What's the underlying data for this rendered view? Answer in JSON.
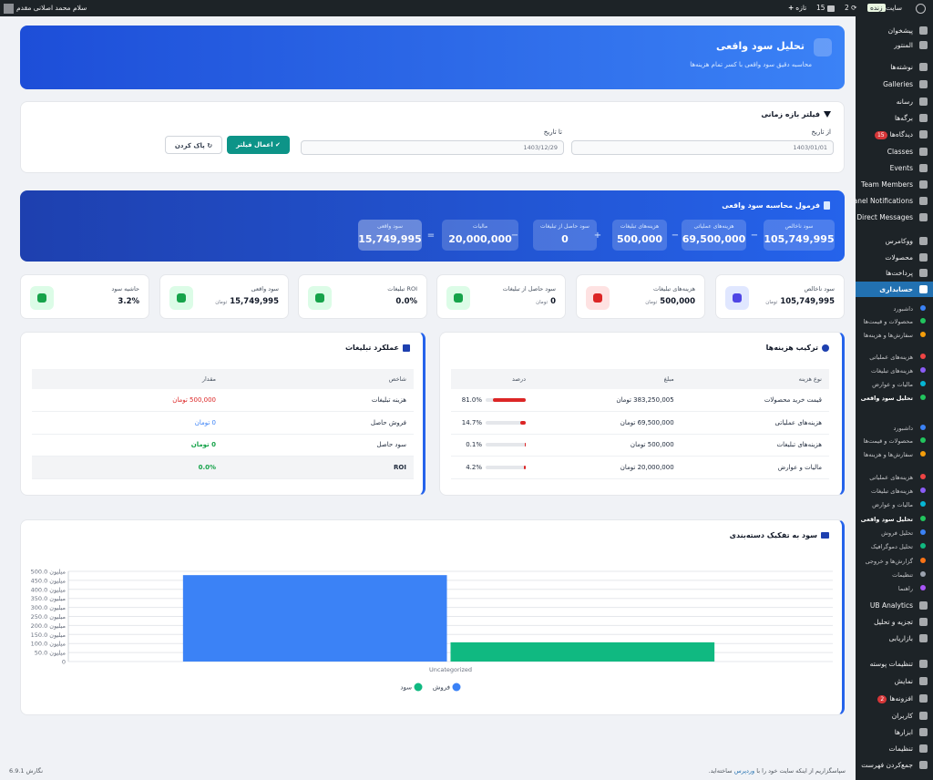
{
  "adminbar": {
    "greeting": "سلام محمد اصلانی مقدم",
    "site_name": "سایت",
    "live_badge": "زنده",
    "updates_count": "2",
    "comments_count": "15",
    "new_label": "تازه"
  },
  "sidebar": {
    "items": [
      {
        "label": "پیشخوان",
        "icon": "dashboard-icon"
      },
      {
        "label": "المنتور",
        "icon": "elementor-icon"
      },
      {
        "label": "نوشته‌ها",
        "icon": "pin-icon"
      },
      {
        "label": "Galleries",
        "icon": "gallery-icon"
      },
      {
        "label": "رسانه",
        "icon": "media-icon"
      },
      {
        "label": "برگه‌ها",
        "icon": "pages-icon"
      },
      {
        "label": "دیدگاه‌ها",
        "icon": "comments-icon",
        "badge": "15"
      },
      {
        "label": "Classes",
        "icon": "classes-icon"
      },
      {
        "label": "Events",
        "icon": "events-icon"
      },
      {
        "label": "Team Members",
        "icon": "team-icon"
      },
      {
        "label": "Panel Notifications",
        "icon": "megaphone-icon"
      },
      {
        "label": "Direct Messages",
        "icon": "messages-icon"
      },
      {
        "label": "ووکامرس",
        "icon": "woocommerce-icon"
      },
      {
        "label": "محصولات",
        "icon": "products-icon"
      },
      {
        "label": "پرداخت‌ها",
        "icon": "payments-icon"
      },
      {
        "label": "حسابداری",
        "icon": "chart-icon"
      }
    ],
    "submenu_a": [
      {
        "label": "داشبورد",
        "color": "#3b82f6"
      },
      {
        "label": "محصولات و قیمت‌ها",
        "color": "#22c55e"
      },
      {
        "label": "سفارش‌ها و هزینه‌ها",
        "color": "#f59e0b"
      },
      {
        "label": "هزینه‌های عملیاتی",
        "color": "#ef4444"
      },
      {
        "label": "هزینه‌های تبلیغات",
        "color": "#8b5cf6"
      },
      {
        "label": "مالیات و عوارض",
        "color": "#06b6d4"
      },
      {
        "label": "تحلیل سود واقعی",
        "color": "#22c55e"
      }
    ],
    "submenu_b": [
      {
        "label": "داشبورد",
        "color": "#3b82f6"
      },
      {
        "label": "محصولات و قیمت‌ها",
        "color": "#22c55e"
      },
      {
        "label": "سفارش‌ها و هزینه‌ها",
        "color": "#f59e0b"
      },
      {
        "label": "هزینه‌های عملیاتی",
        "color": "#ef4444"
      },
      {
        "label": "هزینه‌های تبلیغات",
        "color": "#8b5cf6"
      },
      {
        "label": "مالیات و عوارض",
        "color": "#06b6d4"
      },
      {
        "label": "تحلیل سود واقعی",
        "color": "#22c55e"
      },
      {
        "label": "تحلیل فروش",
        "color": "#3b82f6"
      },
      {
        "label": "تحلیل دموگرافیک",
        "color": "#10b981"
      },
      {
        "label": "گزارش‌ها و خروجی",
        "color": "#f97316"
      },
      {
        "label": "تنظیمات",
        "color": "#9ca3af"
      },
      {
        "label": "راهنما",
        "color": "#a855f7"
      }
    ],
    "items_bottom": [
      {
        "label": "UB Analytics",
        "icon": "analytics-icon"
      },
      {
        "label": "تجزیه و تحلیل",
        "icon": "bar-chart-icon"
      },
      {
        "label": "بازاریابی",
        "icon": "marketing-icon"
      },
      {
        "label": "تنظیمات پوسته",
        "icon": "theme-settings-icon"
      },
      {
        "label": "نمایش",
        "icon": "appearance-icon"
      },
      {
        "label": "افزونه‌ها",
        "icon": "plugins-icon",
        "badge": "2"
      },
      {
        "label": "کاربران",
        "icon": "users-icon"
      },
      {
        "label": "ابزارها",
        "icon": "tools-icon"
      },
      {
        "label": "تنظیمات",
        "icon": "settings-icon"
      },
      {
        "label": "جمع‌کردن فهرست",
        "icon": "collapse-icon"
      }
    ]
  },
  "hero": {
    "title": "تحلیل سود واقعی",
    "subtitle": "محاسبه دقیق سود واقعی با کسر تمام هزینه‌ها"
  },
  "filter": {
    "title": "فیلتر بازه زمانی",
    "from_label": "از تاریخ",
    "from_value": "1403/01/01",
    "to_label": "تا تاریخ",
    "to_value": "1403/12/29",
    "apply_label": "اعمال فیلتر",
    "clear_label": "پاک کردن"
  },
  "formula": {
    "title": "فرمول محاسبه سود واقعی",
    "boxes": [
      {
        "label": "سود ناخالص",
        "value": "105,749,995"
      },
      {
        "label": "هزینه‌های عملیاتی",
        "value": "69,500,000"
      },
      {
        "label": "هزینه‌های تبلیغات",
        "value": "500,000"
      },
      {
        "label": "سود حاصل از تبلیغات",
        "value": "0"
      },
      {
        "label": "مالیات",
        "value": "20,000,000"
      },
      {
        "label": "سود واقعی",
        "value": "15,749,995"
      }
    ],
    "ops": [
      "−",
      "−",
      "+",
      "−",
      "="
    ]
  },
  "kpis": [
    {
      "label": "سود ناخالص",
      "value": "105,749,995",
      "unit": "تومان",
      "icon": "dollar-icon",
      "bg": "#e0e7ff",
      "fg": "#4f46e5"
    },
    {
      "label": "هزینه‌های تبلیغات",
      "value": "500,000",
      "unit": "تومان",
      "icon": "megaphone-icon",
      "bg": "#fee2e2",
      "fg": "#dc2626"
    },
    {
      "label": "سود حاصل از تبلیغات",
      "value": "0",
      "unit": "تومان",
      "icon": "chart-up-icon",
      "bg": "#dcfce7",
      "fg": "#16a34a"
    },
    {
      "label": "ROI تبلیغات",
      "value": "0.0%",
      "unit": "",
      "icon": "gauge-icon",
      "bg": "#dcfce7",
      "fg": "#16a34a"
    },
    {
      "label": "سود واقعی",
      "value": "15,749,995",
      "unit": "تومان",
      "icon": "thumbs-up-icon",
      "bg": "#dcfce7",
      "fg": "#16a34a"
    },
    {
      "label": "حاشیه سود",
      "value": "3.2%",
      "unit": "",
      "icon": "trend-icon",
      "bg": "#dcfce7",
      "fg": "#16a34a"
    }
  ],
  "cost_breakdown": {
    "title": "ترکیب هزینه‌ها",
    "headers": [
      "نوع هزینه",
      "مبلغ",
      "درصد"
    ],
    "rows": [
      {
        "type": "قیمت خرید محصولات",
        "amount": "383,250,005 تومان",
        "percent": "81.0%",
        "fill": 0.81
      },
      {
        "type": "هزینه‌های عملیاتی",
        "amount": "69,500,000 تومان",
        "percent": "14.7%",
        "fill": 0.147
      },
      {
        "type": "هزینه‌های تبلیغات",
        "amount": "500,000 تومان",
        "percent": "0.1%",
        "fill": 0.001
      },
      {
        "type": "مالیات و عوارض",
        "amount": "20,000,000 تومان",
        "percent": "4.2%",
        "fill": 0.042
      }
    ]
  },
  "ad_performance": {
    "title": "عملکرد تبلیغات",
    "headers": [
      "شاخص",
      "مقدار"
    ],
    "rows": [
      {
        "metric": "هزینه تبلیغات",
        "value": "500,000 تومان",
        "color": "#dc2626"
      },
      {
        "metric": "فروش حاصل",
        "value": "0 تومان",
        "color": "#3b82f6"
      },
      {
        "metric": "سود حاصل",
        "value": "0 تومان",
        "color": "#16a34a"
      },
      {
        "metric": "ROI",
        "value": "0.0%",
        "color": "#16a34a"
      }
    ]
  },
  "chart_data": {
    "type": "bar",
    "title": "سود به تفکیک دسته‌بندی",
    "categories": [
      "Uncategorized"
    ],
    "series": [
      {
        "name": "فروش",
        "values": [
          479.0
        ],
        "color": "#3b82f6"
      },
      {
        "name": "سود",
        "values": [
          106.5
        ],
        "color": "#10b981"
      }
    ],
    "ylim": [
      0,
      500
    ],
    "yticks": [
      "0",
      "50.0 میلیون",
      "100.0 میلیون",
      "150.0 میلیون",
      "200.0 میلیون",
      "250.0 میلیون",
      "300.0 میلیون",
      "350.0 میلیون",
      "400.0 میلیون",
      "450.0 میلیون",
      "500.0 میلیون"
    ],
    "legend": "bottom",
    "grid": true
  },
  "footer": {
    "thanks_before": "سپاسگزاریم از اینکه سایت خود را با",
    "thanks_link": "وردپرس",
    "thanks_after": "ساخته‌اید.",
    "version": "نگارش 6.9.1"
  }
}
